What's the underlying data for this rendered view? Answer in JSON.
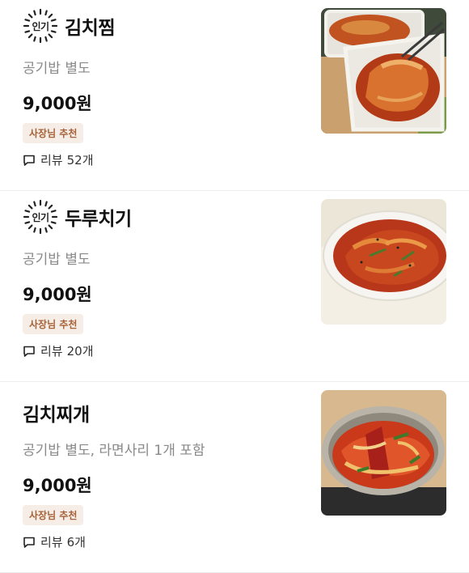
{
  "menu": [
    {
      "badge": "인기",
      "name": "김치찜",
      "description": "공기밥 별도",
      "price": "9,000원",
      "recommendation": "사장님 추천",
      "review_label": "리뷰",
      "review_count": "52개",
      "image_icon": "kimchi-jjim-photo"
    },
    {
      "badge": "인기",
      "name": "두루치기",
      "description": "공기밥 별도",
      "price": "9,000원",
      "recommendation": "사장님 추천",
      "review_label": "리뷰",
      "review_count": "20개",
      "image_icon": "duruchigi-photo"
    },
    {
      "name": "김치찌개",
      "description": "공기밥 별도, 라면사리 1개 포함",
      "price": "9,000원",
      "recommendation": "사장님 추천",
      "review_label": "리뷰",
      "review_count": "6개",
      "image_icon": "kimchi-jjigae-photo"
    }
  ],
  "colors": {
    "recommend_bg": "#f6eee6",
    "recommend_text": "#a5623a",
    "description": "#8a8a8a"
  }
}
